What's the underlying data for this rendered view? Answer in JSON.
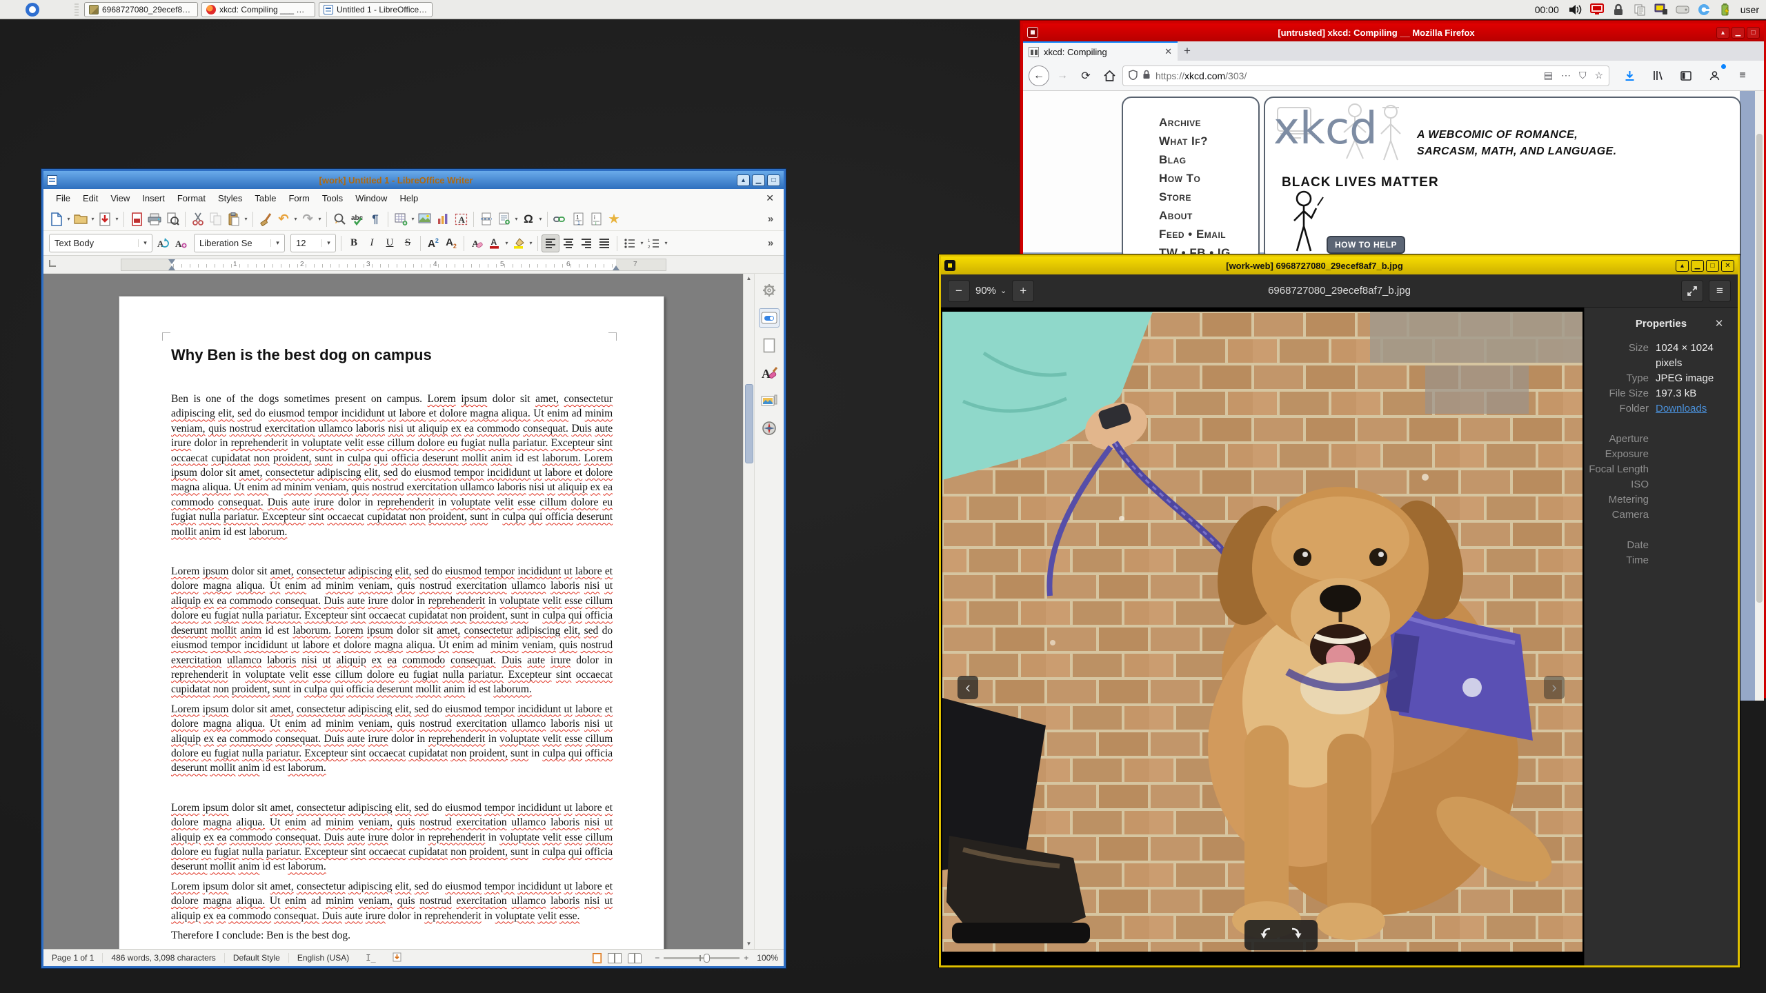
{
  "taskbar": {
    "clock": "00:00",
    "user": "user",
    "windows": [
      {
        "label": "6968727080_29ecef8af...",
        "icon": "image-file-icon"
      },
      {
        "label": "xkcd: Compiling ___ Moz...",
        "icon": "firefox-icon"
      },
      {
        "label": "Untitled 1 - LibreOffice W...",
        "icon": "writer-icon"
      }
    ],
    "tray_icons": [
      "volume-icon",
      "red-vm-screen-icon",
      "lock-icon",
      "clipboard-icon",
      "vm-settings-icon",
      "disk-icon",
      "qubes-icon",
      "battery-icon"
    ]
  },
  "writer": {
    "title": "[work] Untitled 1 - LibreOffice Writer",
    "menus": [
      "File",
      "Edit",
      "View",
      "Insert",
      "Format",
      "Styles",
      "Table",
      "Form",
      "Tools",
      "Window",
      "Help"
    ],
    "close_glyph": "✕",
    "toolbar_icons": [
      "new-document",
      "open",
      "save",
      "export-pdf",
      "print",
      "print-preview",
      "cut",
      "copy",
      "paste",
      "clone-formatting",
      "undo",
      "redo",
      "find-replace",
      "spelling",
      "formatting-marks",
      "insert-table",
      "insert-image",
      "insert-chart",
      "insert-text-box",
      "page-break",
      "insert-field",
      "special-character",
      "insert-hyperlink",
      "insert-footnote",
      "insert-endnote",
      "insert-bookmark",
      "toolbar-overflow"
    ],
    "style_combo": "Text Body",
    "font_combo": "Liberation Se",
    "size_combo": "12",
    "format_icons": [
      "bold",
      "italic",
      "underline",
      "strikethrough",
      "superscript",
      "subscript",
      "clear-formatting",
      "font-color",
      "highlight-color",
      "align-left",
      "align-center",
      "align-right",
      "justify",
      "bullet-list",
      "numbered-list",
      "toolbar-overflow"
    ],
    "ruler_numbers": [
      "1",
      "2",
      "3",
      "4",
      "5",
      "6",
      "7"
    ],
    "sidebar_icons": [
      "sidebar-settings-gear",
      "properties-deck",
      "page-deck",
      "styles-deck",
      "gallery-deck",
      "navigator-deck"
    ],
    "document": {
      "heading": "Why Ben is the best dog on campus",
      "paragraphs": [
        "Ben is one of the dogs sometimes present on campus. Lorem ipsum dolor sit amet, consectetur adipiscing elit, sed do eiusmod tempor incididunt ut labore et dolore magna aliqua. Ut enim ad minim veniam, quis nostrud exercitation ullamco laboris nisi ut aliquip ex ea commodo consequat. Duis aute irure dolor in reprehenderit in voluptate velit esse cillum dolore eu fugiat nulla pariatur. Excepteur sint occaecat cupidatat non proident, sunt in culpa qui officia deserunt mollit anim id est laborum. Lorem ipsum dolor sit amet, consectetur adipiscing elit, sed do eiusmod tempor incididunt ut labore et dolore magna aliqua. Ut enim ad minim veniam, quis nostrud exercitation ullamco laboris nisi ut aliquip ex ea commodo consequat. Duis aute irure dolor in reprehenderit in voluptate velit esse cillum dolore eu fugiat nulla pariatur. Excepteur sint occaecat cupidatat non proident, sunt in culpa qui officia deserunt mollit anim id est laborum.",
        "Lorem ipsum dolor sit amet, consectetur adipiscing elit, sed do eiusmod tempor incididunt ut labore et dolore magna aliqua. Ut enim ad minim veniam, quis nostrud exercitation ullamco laboris nisi ut aliquip ex ea commodo consequat. Duis aute irure dolor in reprehenderit in voluptate velit esse cillum dolore eu fugiat nulla pariatur. Excepteur sint occaecat cupidatat non proident, sunt in culpa qui officia deserunt mollit anim id est laborum. Lorem ipsum dolor sit amet, consectetur adipiscing elit, sed do eiusmod tempor incididunt ut labore et dolore magna aliqua. Ut enim ad minim veniam, quis nostrud exercitation ullamco laboris nisi ut aliquip ex ea commodo consequat. Duis aute irure dolor in reprehenderit in voluptate velit esse cillum dolore eu fugiat nulla pariatur. Excepteur sint occaecat cupidatat non proident, sunt in culpa qui officia deserunt mollit anim id est laborum.",
        "Lorem ipsum dolor sit amet, consectetur adipiscing elit, sed do eiusmod tempor incididunt ut labore et dolore magna aliqua. Ut enim ad minim veniam, quis nostrud exercitation ullamco laboris nisi ut aliquip ex ea commodo consequat. Duis aute irure dolor in reprehenderit in voluptate velit esse cillum dolore eu fugiat nulla pariatur. Excepteur sint occaecat cupidatat non proident, sunt in culpa qui officia deserunt mollit anim id est laborum.",
        "Lorem ipsum dolor sit amet, consectetur adipiscing elit, sed do eiusmod tempor incididunt ut labore et dolore magna aliqua. Ut enim ad minim veniam, quis nostrud exercitation ullamco laboris nisi ut aliquip ex ea commodo consequat. Duis aute irure dolor in reprehenderit in voluptate velit esse cillum dolore eu fugiat nulla pariatur. Excepteur sint occaecat cupidatat non proident, sunt in culpa qui officia deserunt mollit anim id est laborum.",
        "Lorem ipsum dolor sit amet, consectetur adipiscing elit, sed do eiusmod tempor incididunt ut labore et dolore magna aliqua. Ut enim ad minim veniam, quis nostrud exercitation ullamco laboris nisi ut aliquip ex ea commodo consequat. Duis aute irure dolor in reprehenderit in voluptate velit esse.",
        "Therefore I conclude: Ben is the best dog."
      ]
    },
    "statusbar": {
      "page": "Page 1 of 1",
      "words": "486 words, 3,098 characters",
      "style": "Default Style",
      "language": "English (USA)",
      "zoom": "100%"
    }
  },
  "spell_ok": [
    "ben",
    "is",
    "one",
    "of",
    "the",
    "dogs",
    "sometimes",
    "present",
    "on",
    "campus",
    "in",
    "ad",
    "do",
    "dolor",
    "sit",
    "id",
    "est",
    "therefore",
    "i",
    "conclude",
    "best",
    "dog"
  ],
  "firefox": {
    "title": "[untrusted] xkcd: Compiling __ Mozilla Firefox",
    "tab_label": "xkcd: Compiling",
    "urlbar": {
      "scheme": "https://",
      "host": "xkcd.com",
      "path": "/303/"
    },
    "nav_icons": [
      "back-icon",
      "forward-icon",
      "reload-icon",
      "home-icon",
      "shield-icon",
      "lock-icon",
      "reader-mode-icon",
      "page-actions-icon",
      "protection-icon",
      "bookmark-star-icon",
      "downloads-icon",
      "library-icon",
      "sidebar-icon",
      "account-icon",
      "menu-icon"
    ],
    "xkcd": {
      "logo": "xkcd",
      "nav": [
        "Archive",
        "What If?",
        "Blag",
        "How To",
        "Store",
        "About",
        "Feed • Email",
        "TW • FB • IG"
      ],
      "tagline_line1": "A WEBCOMIC OF ROMANCE,",
      "tagline_line2": "SARCASM, MATH, AND LANGUAGE.",
      "blm": "BLACK LIVES MATTER",
      "help_button": "HOW TO HELP",
      "bg_color": "#96a8c8"
    }
  },
  "viewer": {
    "title": "[work-web] 6968727080_29ecef8af7_b.jpg",
    "zoom_level": "90%",
    "filename": "6968727080_29ecef8af7_b.jpg",
    "header_icons": [
      "zoom-out-icon",
      "zoom-dropdown-icon",
      "zoom-in-icon",
      "fullscreen-icon",
      "menu-icon"
    ],
    "overlay_icons": [
      "previous-image-icon",
      "next-image-icon",
      "rotate-left-icon",
      "rotate-right-icon"
    ],
    "properties": {
      "header": "Properties",
      "rows": [
        {
          "label": "Size",
          "value": "1024 × 1024 pixels"
        },
        {
          "label": "Type",
          "value": "JPEG image"
        },
        {
          "label": "File Size",
          "value": "197.3 kB"
        },
        {
          "label": "Folder",
          "value": "Downloads"
        },
        {
          "label": "Aperture",
          "value": ""
        },
        {
          "label": "Exposure",
          "value": ""
        },
        {
          "label": "Focal Length",
          "value": ""
        },
        {
          "label": "ISO",
          "value": ""
        },
        {
          "label": "Metering",
          "value": ""
        },
        {
          "label": "Camera",
          "value": ""
        },
        {
          "label": "Date",
          "value": ""
        },
        {
          "label": "Time",
          "value": ""
        }
      ],
      "link_color": "#4a90d9"
    }
  }
}
